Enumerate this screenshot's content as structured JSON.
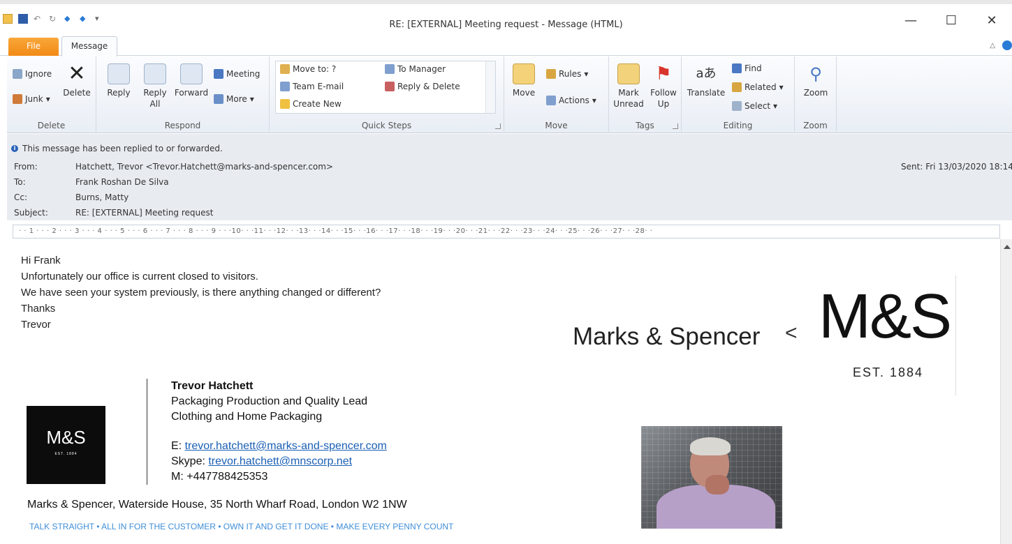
{
  "window": {
    "title": "RE: [EXTERNAL] Meeting request  -  Message (HTML)",
    "controls": [
      "—",
      "☐",
      "✕"
    ]
  },
  "tabs": {
    "file": "File",
    "message": "Message"
  },
  "ribbon": {
    "delete_group": {
      "label": "Delete",
      "ignore": "Ignore",
      "junk": "Junk",
      "delete": "Delete"
    },
    "respond_group": {
      "label": "Respond",
      "reply": "Reply",
      "reply_all_1": "Reply",
      "reply_all_2": "All",
      "forward": "Forward",
      "meeting": "Meeting",
      "more": "More"
    },
    "quick_steps": {
      "label": "Quick Steps",
      "move_to": "Move to: ?",
      "team_email": "Team E-mail",
      "create_new": "Create New",
      "to_manager": "To Manager",
      "reply_delete": "Reply & Delete"
    },
    "move_group": {
      "label": "Move",
      "move": "Move",
      "rules": "Rules",
      "actions": "Actions"
    },
    "tags_group": {
      "label": "Tags",
      "mark_unread_1": "Mark",
      "mark_unread_2": "Unread",
      "follow_up_1": "Follow",
      "follow_up_2": "Up"
    },
    "editing_group": {
      "label": "Editing",
      "translate": "Translate",
      "find": "Find",
      "related": "Related",
      "select": "Select"
    },
    "zoom_group": {
      "label": "Zoom",
      "zoom": "Zoom"
    }
  },
  "header": {
    "info": "This message has been replied to or forwarded.",
    "from_label": "From:",
    "from": "Hatchett, Trevor <Trevor.Hatchett@marks-and-spencer.com>",
    "to_label": "To:",
    "to": "Frank Roshan De Silva",
    "cc_label": "Cc:",
    "cc": "Burns, Matty",
    "subject_label": "Subject:",
    "subject": "RE: [EXTERNAL] Meeting request",
    "sent_label": "Sent:",
    "sent": "Fri 13/03/2020 18:14"
  },
  "ruler": "· · 1 · · · 2 · · · 3 · · · 4 · · · 5 · · · 6 · · · 7 · · · 8 · · · 9 · · ·10· · ·11· · ·12· · ·13· · ·14· · ·15· · ·16· · ·17· · ·18· · ·19· · ·20· · ·21· · ·22· · ·23· · ·24· · ·25· · ·26· · ·27· · ·28· ·",
  "message": {
    "lines": [
      "Hi Frank",
      "Unfortunately our office is current closed to visitors.",
      "We have seen your system previously, is there anything changed or different?",
      "Thanks",
      "Trevor"
    ]
  },
  "banner": {
    "brand": "Marks & Spencer",
    "chevron": "<",
    "logo": "M&S",
    "est": "EST. 1884"
  },
  "signature": {
    "logo_text": "M&S",
    "logo_small": "EST. 1884",
    "name": "Trevor Hatchett",
    "role": "Packaging Production and Quality Lead",
    "dept": "Clothing and Home Packaging",
    "email_label": "E: ",
    "email": "trevor.hatchett@marks-and-spencer.com",
    "skype_label": "Skype: ",
    "skype": "trevor.hatchett@mnscorp.net",
    "mobile": "M: +447788425353",
    "address": "Marks & Spencer, Waterside House, 35 North Wharf Road, London W2 1NW",
    "values": "TALK STRAIGHT • ALL IN FOR THE CUSTOMER • OWN IT AND GET IT DONE • MAKE EVERY PENNY COUNT"
  },
  "colors": {
    "file_tab": "#f18a15",
    "link": "#1a5fb4",
    "values_text": "#3f8ed8",
    "header_bg": "#e8ecf1"
  }
}
